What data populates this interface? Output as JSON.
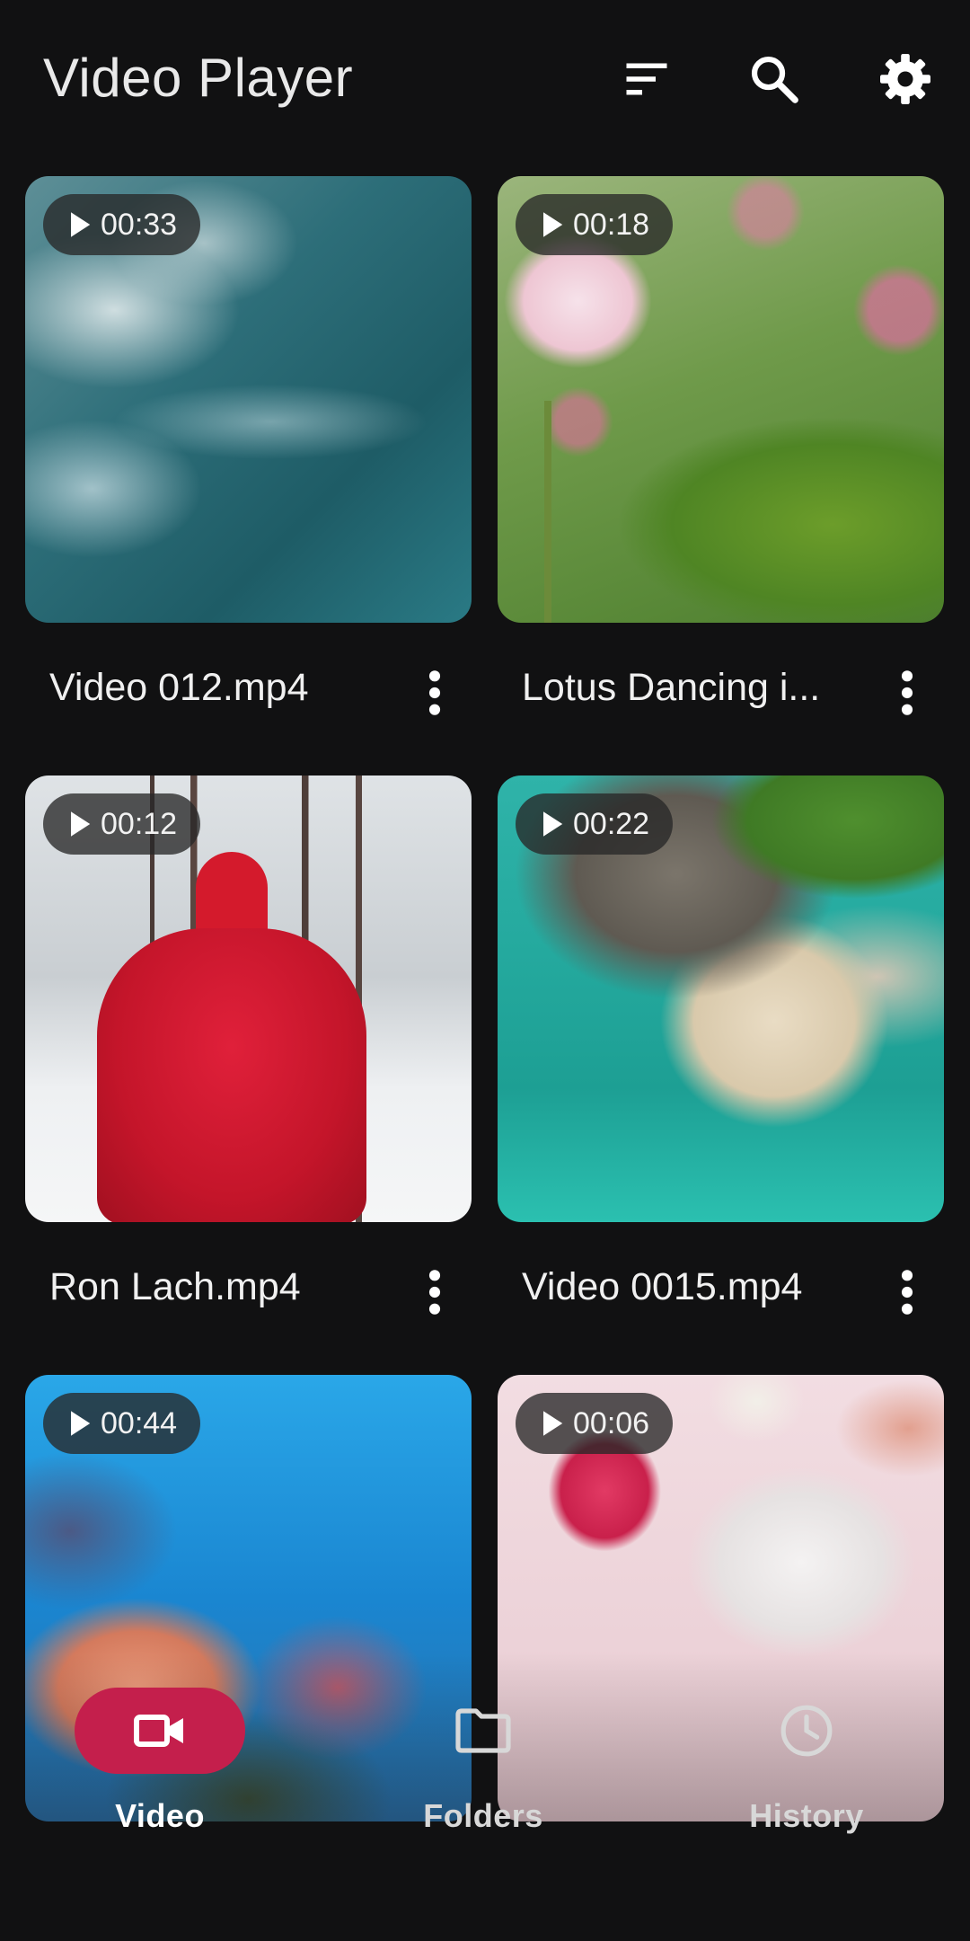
{
  "app": {
    "title": "Video Player"
  },
  "toolbar": {
    "sort_icon": "sort-icon",
    "search_icon": "search-icon",
    "settings_icon": "gear-icon"
  },
  "videos": [
    {
      "name": "Video 012.mp4",
      "duration": "00:33",
      "thumb": "ocean-waves"
    },
    {
      "name": "Lotus Dancing i...",
      "duration": "00:18",
      "thumb": "lotus-flower"
    },
    {
      "name": "Ron Lach.mp4",
      "duration": "00:12",
      "thumb": "red-dress-snow"
    },
    {
      "name": "Video 0015.mp4",
      "duration": "00:22",
      "thumb": "rocky-beach"
    },
    {
      "name": "",
      "duration": "00:44",
      "thumb": "coral-reef"
    },
    {
      "name": "",
      "duration": "00:06",
      "thumb": "pink-heart-dish"
    }
  ],
  "nav": {
    "items": [
      {
        "label": "Video",
        "icon": "videocam-icon",
        "active": true
      },
      {
        "label": "Folders",
        "icon": "folder-icon",
        "active": false
      },
      {
        "label": "History",
        "icon": "clock-icon",
        "active": false
      }
    ]
  },
  "colors": {
    "accent": "#c41f4c",
    "background": "#111112"
  }
}
